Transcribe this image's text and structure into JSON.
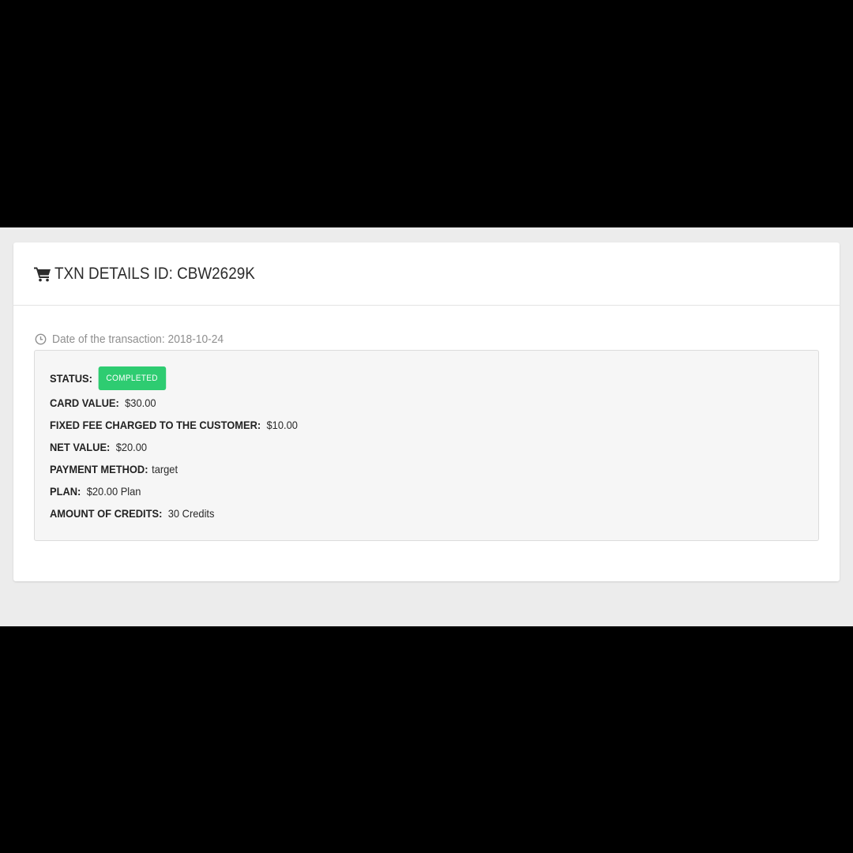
{
  "header": {
    "icon": "shopping-cart-icon",
    "title": "TXN DETAILS ID: CBW2629K"
  },
  "transaction_date": {
    "icon": "clock-icon",
    "text": "Date of the transaction: 2018-10-24"
  },
  "status": {
    "label": "STATUS:",
    "badge": "COMPLETED",
    "badge_color": "#2ecc71"
  },
  "details": [
    {
      "label": "CARD VALUE:",
      "value": "$30.00"
    },
    {
      "label": "FIXED FEE CHARGED TO THE CUSTOMER:",
      "value": "$10.00"
    },
    {
      "label": "NET VALUE:",
      "value": "$20.00"
    },
    {
      "label": "PAYMENT METHOD:",
      "value": "target"
    },
    {
      "label": "PLAN:",
      "value": "$20.00 Plan"
    },
    {
      "label": "AMOUNT OF CREDITS:",
      "value": "30 Credits"
    }
  ]
}
